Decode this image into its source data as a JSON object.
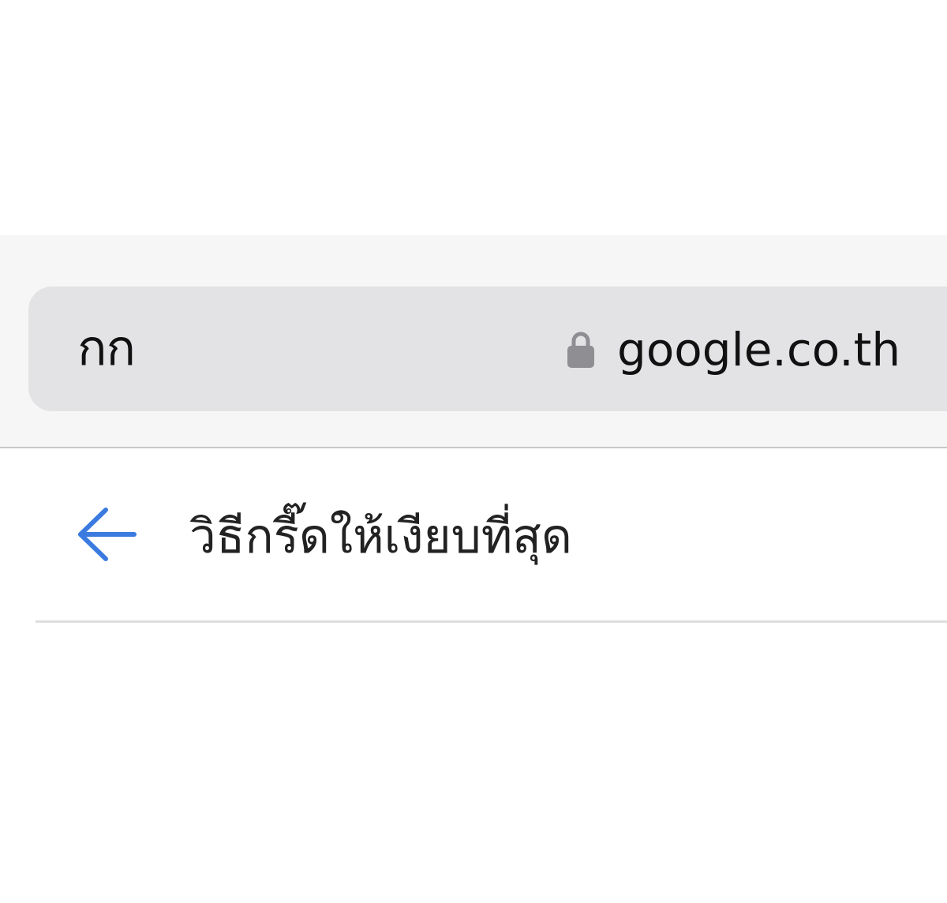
{
  "browser": {
    "text_size_label": "กก",
    "url": "google.co.th",
    "lock_icon": "lock-icon",
    "lock_color": "#8e8e93"
  },
  "search": {
    "back_icon": "back-arrow-icon",
    "back_color": "#3b7be0",
    "query": "วิธีกรี๊ดให้เงียบที่สุด"
  }
}
